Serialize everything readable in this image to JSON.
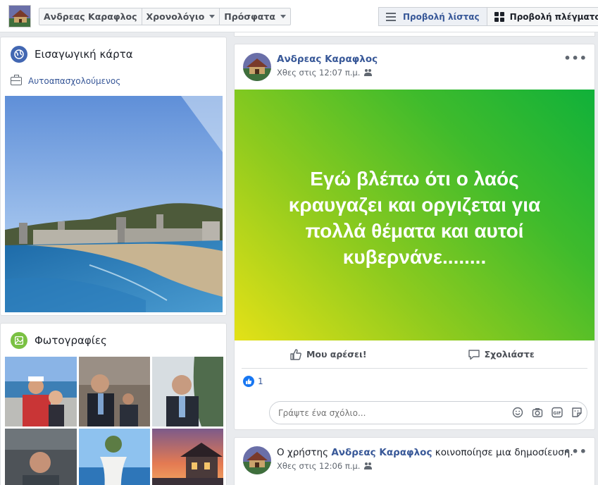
{
  "topbar": {
    "profile_name": "Ανδρεας Καραφλος",
    "timeline_label": "Χρονολόγιο",
    "recent_label": "Πρόσφατα",
    "list_view_label": "Προβολή λίστας",
    "grid_view_label": "Προβολή πλέγματος"
  },
  "intro": {
    "title": "Εισαγωγική κάρτα",
    "work": "Αυτοαπασχολούμενος"
  },
  "photos": {
    "title": "Φωτογραφίες"
  },
  "post1": {
    "author": "Ανδρεας Καραφλος",
    "time": "Χθες στις 12:07 π.μ.",
    "text": "Εγώ βλέπω ότι ο λαός κραυγαζει και οργιζεται για πολλά θέματα και αυτοί κυβερνάνε........",
    "like_label": "Μου αρέσει!",
    "comment_label": "Σχολιάστε",
    "like_count": "1",
    "comment_placeholder": "Γράψτε ένα σχόλιο..."
  },
  "post2": {
    "prefix": "Ο χρήστης",
    "author": "Ανδρεας Καραφλος",
    "suffix": "κοινοποίησε μια δημοσίευση.",
    "time": "Χθες στις 12:06 π.μ."
  },
  "colors": {
    "link": "#385898",
    "banner_start": "#e4e117",
    "banner_end": "#10b13a"
  }
}
